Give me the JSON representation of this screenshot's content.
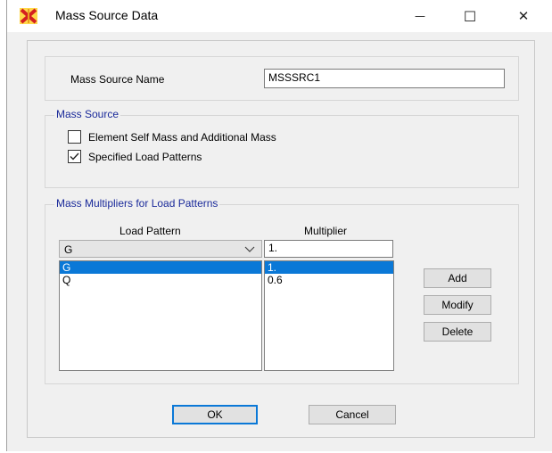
{
  "window": {
    "title": "Mass Source Data",
    "minimize_glyph": "—",
    "maximize_glyph": "☐",
    "close_glyph": "✕",
    "app_icon": "etabs-app-icon"
  },
  "name_section": {
    "label": "Mass Source Name",
    "value": "MSSSRC1"
  },
  "mass_source": {
    "legend": "Mass Source",
    "options": [
      {
        "label": "Element Self Mass and Additional Mass",
        "checked": false
      },
      {
        "label": "Specified Load Patterns",
        "checked": true
      }
    ]
  },
  "multipliers": {
    "legend": "Mass Multipliers for Load Patterns",
    "load_pattern_header": "Load Pattern",
    "multiplier_header": "Multiplier",
    "load_pattern_selected": "G",
    "multiplier_value": "1.",
    "rows": [
      {
        "pattern": "G",
        "multiplier": "1.",
        "selected": true
      },
      {
        "pattern": "Q",
        "multiplier": "0.6",
        "selected": false
      }
    ],
    "buttons": {
      "add": "Add",
      "modify": "Modify",
      "delete": "Delete"
    }
  },
  "footer": {
    "ok": "OK",
    "cancel": "Cancel"
  },
  "colors": {
    "legend_text": "#1a2a9a",
    "selection": "#0a78d7",
    "default_button_border": "#0a78d7"
  }
}
